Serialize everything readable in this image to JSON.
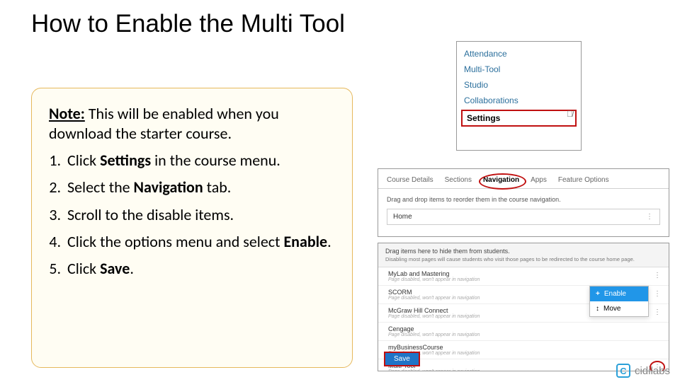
{
  "title": "How to Enable the Multi Tool",
  "note": {
    "label": "Note:",
    "text": "This will be enabled when you download the starter course."
  },
  "steps": {
    "s1a": "Click ",
    "s1b": "Settings",
    "s1c": " in the course menu.",
    "s2a": "Select the ",
    "s2b": "Navigation",
    "s2c": " tab.",
    "s3": "Scroll to the disable items.",
    "s4a": "Click the options menu and select ",
    "s4b": "Enable",
    "s4c": ".",
    "s5a": "Click ",
    "s5b": "Save",
    "s5c": "."
  },
  "sidebar": {
    "items": [
      "Attendance",
      "Multi-Tool",
      "Studio",
      "Collaborations",
      "Settings"
    ]
  },
  "tabs": {
    "items": [
      "Course Details",
      "Sections",
      "Navigation",
      "Apps",
      "Feature Options"
    ],
    "desc": "Drag and drop items to reorder them in the course navigation.",
    "home": "Home",
    "dots": "⋮"
  },
  "disabled": {
    "header": "Drag items here to hide them from students.",
    "header_sub": "Disabling most pages will cause students who visit those pages to be redirected to the course home page.",
    "items": [
      {
        "name": "MyLab and Mastering",
        "sub": "Page disabled, won't appear in navigation"
      },
      {
        "name": "SCORM",
        "sub": "Page disabled, won't appear in navigation"
      },
      {
        "name": "McGraw Hill Connect",
        "sub": "Page disabled, won't appear in navigation"
      },
      {
        "name": "Cengage",
        "sub": "Page disabled, won't appear in navigation"
      },
      {
        "name": "myBusinessCourse",
        "sub": "Page disabled, won't appear in navigation"
      },
      {
        "name": "Multi-Tool",
        "sub": "Page disabled, won't appear in navigation"
      }
    ],
    "dots": "⋮",
    "popover": {
      "enable": "Enable",
      "move": "Move",
      "plus": "+",
      "arrows": "↕"
    },
    "save": "Save"
  },
  "logo": {
    "badge": "C",
    "text": "cidilabs"
  }
}
